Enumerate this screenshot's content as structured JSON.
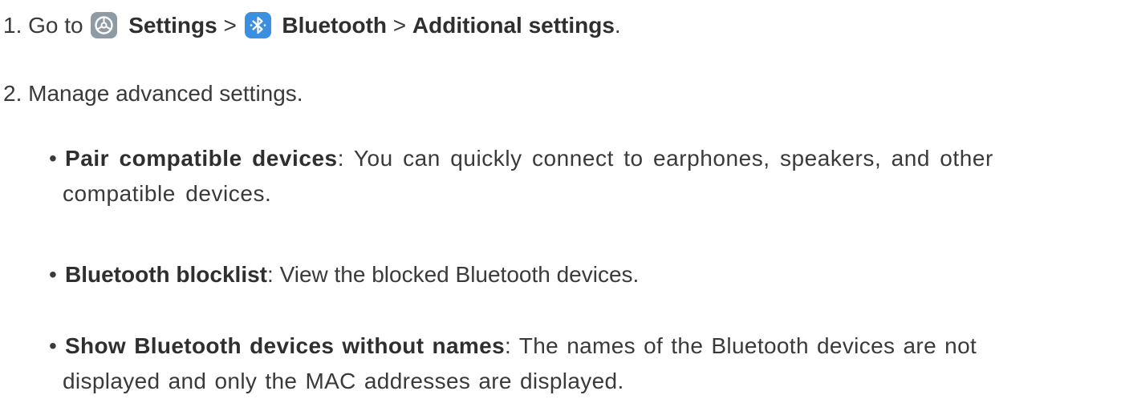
{
  "steps": {
    "step1": {
      "prefix": "1. Go to",
      "settings_icon": "settings-gear-icon",
      "settings_label": "Settings",
      "separator1": ">",
      "bluetooth_icon": "bluetooth-icon",
      "bluetooth_label": "Bluetooth",
      "separator2": ">",
      "additional_label": "Additional settings",
      "end": "."
    },
    "step2": {
      "text": "2. Manage advanced settings."
    }
  },
  "bullets": [
    {
      "marker": "•",
      "term": "Pair compatible devices",
      "sep": ":",
      "line1": "You can quickly connect to earphones, speakers, and other",
      "line2": "compatible devices."
    },
    {
      "marker": "•",
      "term": "Bluetooth blocklist",
      "sep": ":",
      "line1": "View the blocked Bluetooth devices."
    },
    {
      "marker": "•",
      "term": "Show Bluetooth devices without names",
      "sep": ":",
      "line1": "The names of the Bluetooth devices are not",
      "line2": "displayed and only the MAC addresses are displayed."
    }
  ],
  "colors": {
    "text": "#3a3a3a",
    "settings_icon_bg": "#8e9aa4",
    "bluetooth_icon_bg": "#3b8fe0"
  }
}
